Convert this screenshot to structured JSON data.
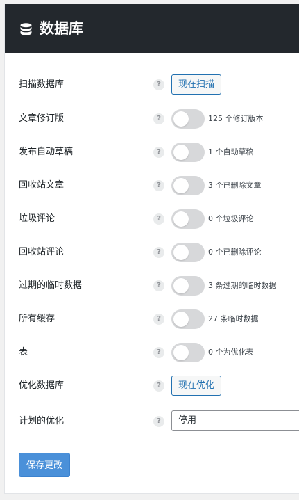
{
  "header": {
    "icon": "database-icon",
    "title": "数据库"
  },
  "rows": [
    {
      "label": "扫描数据库",
      "help": "?",
      "control": "button",
      "button_label": "现在扫描"
    },
    {
      "label": "文章修订版",
      "help": "?",
      "control": "toggle",
      "enabled": false,
      "desc": "125 个修订版本"
    },
    {
      "label": "发布自动草稿",
      "help": "?",
      "control": "toggle",
      "enabled": false,
      "desc": "1 个自动草稿"
    },
    {
      "label": "回收站文章",
      "help": "?",
      "control": "toggle",
      "enabled": false,
      "desc": "3 个已删除文章"
    },
    {
      "label": "垃圾评论",
      "help": "?",
      "control": "toggle",
      "enabled": false,
      "desc": "0 个垃圾评论"
    },
    {
      "label": "回收站评论",
      "help": "?",
      "control": "toggle",
      "enabled": false,
      "desc": "0 个已删除评论"
    },
    {
      "label": "过期的临时数据",
      "help": "?",
      "control": "toggle",
      "enabled": false,
      "desc": "3 条过期的临时数据"
    },
    {
      "label": "所有缓存",
      "help": "?",
      "control": "toggle",
      "enabled": false,
      "desc": "27 条临时数据"
    },
    {
      "label": "表",
      "help": "?",
      "control": "toggle",
      "enabled": false,
      "desc": "0 个为优化表"
    },
    {
      "label": "优化数据库",
      "help": "?",
      "control": "button",
      "button_label": "现在优化"
    },
    {
      "label": "计划的优化",
      "help": "?",
      "control": "select",
      "selected": "停用"
    }
  ],
  "save_button": "保存更改",
  "colors": {
    "header_bg": "#23282d",
    "accent": "#2271b1",
    "save_bg": "#4a90d9",
    "toggle_off": "#d7d8da"
  }
}
